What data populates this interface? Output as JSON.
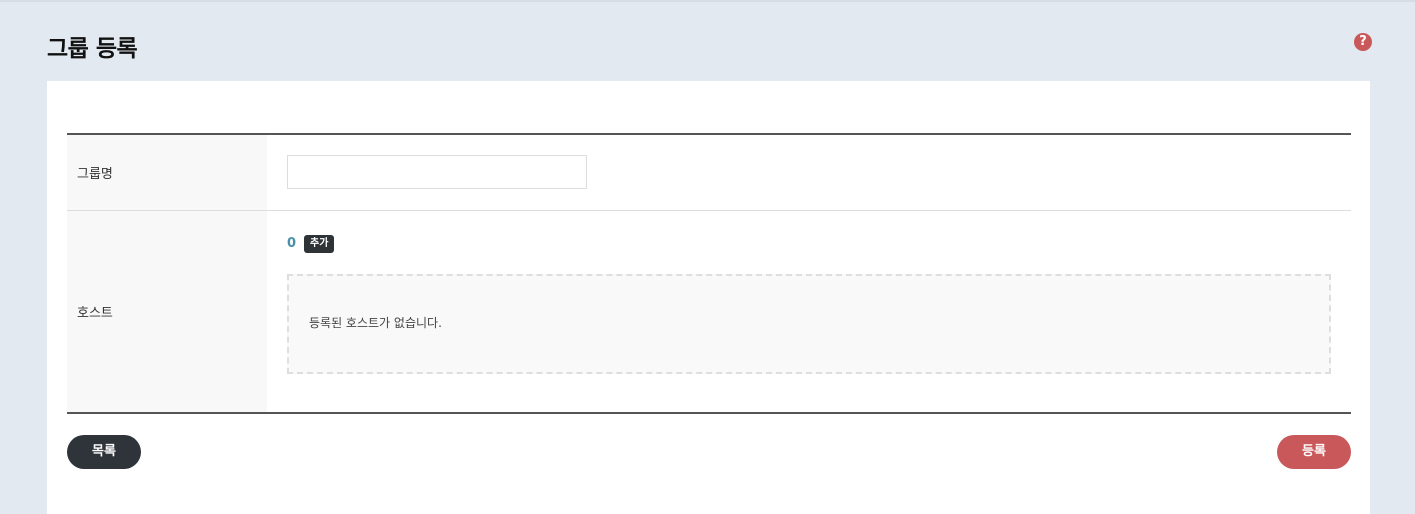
{
  "page": {
    "title": "그룹 등록",
    "help_icon": "question-circle-icon",
    "help_glyph": "?"
  },
  "form": {
    "group_name": {
      "label": "그룹명",
      "value": "",
      "placeholder": ""
    },
    "host": {
      "label": "호스트",
      "count": "0",
      "add_label": "추가",
      "empty_message": "등록된 호스트가 없습니다."
    }
  },
  "actions": {
    "list_label": "목록",
    "register_label": "등록"
  },
  "colors": {
    "background": "#e2e9f0",
    "accent_red": "#c9585a",
    "dark_button": "#2f343a",
    "count_blue": "#4a90a8"
  }
}
